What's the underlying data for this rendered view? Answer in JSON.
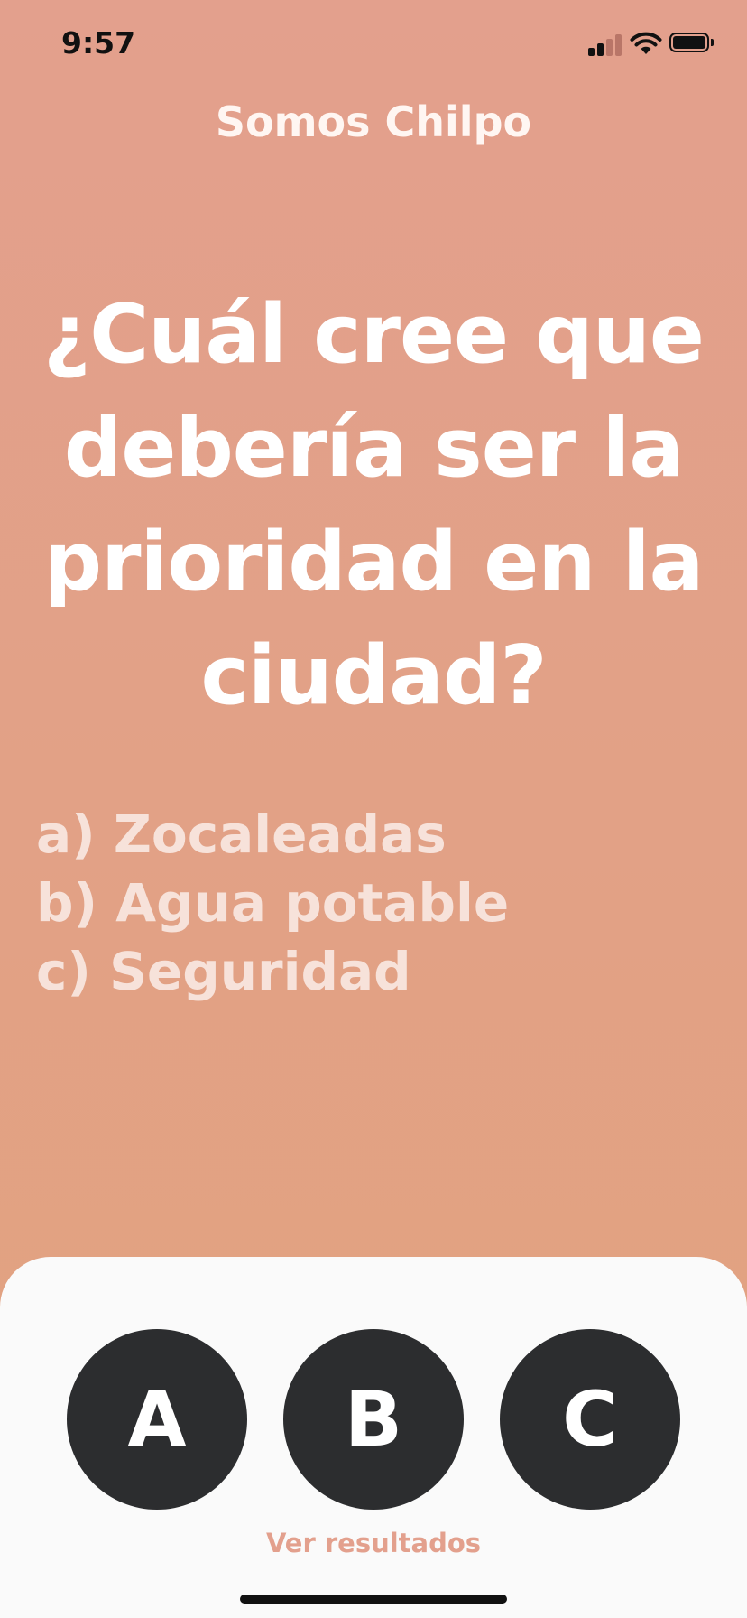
{
  "status_bar": {
    "time": "9:57",
    "icons": [
      "cellular-signal-icon",
      "wifi-icon",
      "battery-icon"
    ]
  },
  "header": {
    "title": "Somos Chilpo"
  },
  "poll": {
    "question": "¿Cuál cree que debería ser la prioridad en la ciudad?",
    "options": [
      "a) Zocaleadas",
      "b) Agua potable",
      "c) Seguridad"
    ]
  },
  "answer_buttons": {
    "a": "A",
    "b": "B",
    "c": "C"
  },
  "results_link": "Ver resultados",
  "colors": {
    "background": "#e3a08d",
    "sheet": "#fafafa",
    "button": "#2c2d2f",
    "accent_text": "#e3a08d"
  }
}
